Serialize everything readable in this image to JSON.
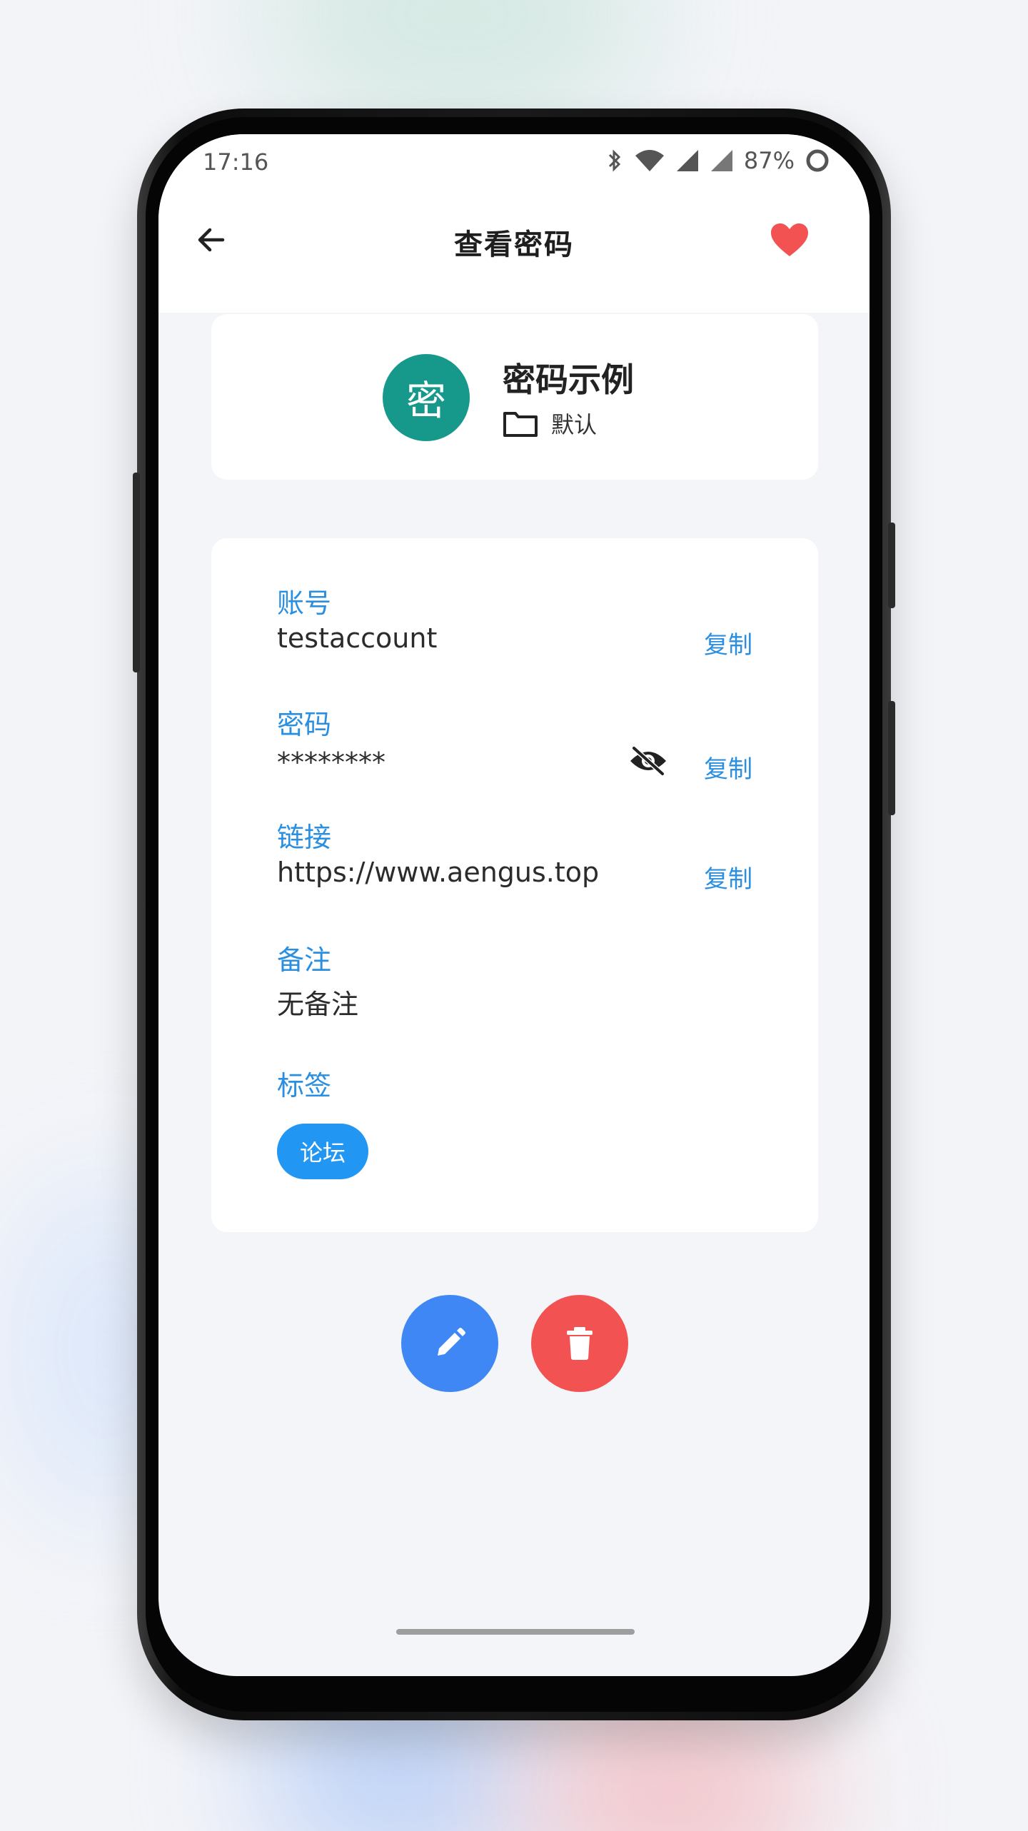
{
  "status_bar": {
    "time": "17:16",
    "battery": "87%"
  },
  "app_bar": {
    "title": "查看密码",
    "favorite_color": "#f25252"
  },
  "entry": {
    "avatar_char": "密",
    "avatar_color": "#16998a",
    "title": "密码示例",
    "folder": "默认"
  },
  "fields": {
    "account": {
      "label": "账号",
      "value": "testaccount",
      "copy": "复制"
    },
    "password": {
      "label": "密码",
      "value": "********",
      "copy": "复制"
    },
    "link": {
      "label": "链接",
      "value": "https://www.aengus.top",
      "copy": "复制"
    },
    "note": {
      "label": "备注",
      "value": "无备注"
    },
    "tags": {
      "label": "标签",
      "items": [
        "论坛"
      ]
    }
  },
  "colors": {
    "accent": "#2a8fe0",
    "tag_bg": "#2196f3",
    "edit_button": "#3f87f5",
    "delete_button": "#f25252"
  },
  "icons": {
    "back": "arrow-left-icon",
    "favorite": "heart-icon",
    "folder": "folder-icon",
    "visibility": "eye-off-icon",
    "edit": "pencil-icon",
    "delete": "trash-icon"
  }
}
